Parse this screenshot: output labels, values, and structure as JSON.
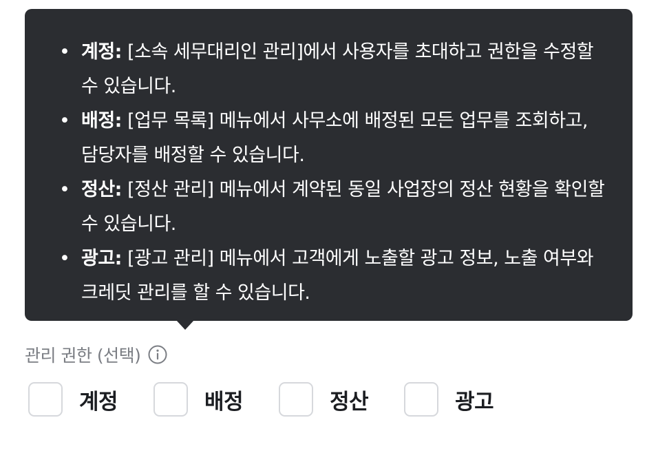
{
  "tooltip": {
    "items": [
      {
        "term": "계정:",
        "text": " [소속 세무대리인 관리]에서 사용자를 초대하고 권한을 수정할 수 있습니다."
      },
      {
        "term": "배정:",
        "text": " [업무 목록] 메뉴에서 사무소에 배정된 모든 업무를 조회하고, 담당자를 배정할 수 있습니다."
      },
      {
        "term": "정산:",
        "text": " [정산 관리] 메뉴에서 계약된 동일 사업장의 정산 현황을 확인할 수 있습니다."
      },
      {
        "term": "광고:",
        "text": " [광고 관리] 메뉴에서 고객에게 노출할 광고 정보, 노출 여부와 크레딧 관리를 할 수 있습니다."
      }
    ]
  },
  "permissions": {
    "label": "관리 권한 (선택)",
    "info_icon": "info-circle-icon",
    "options": [
      {
        "label": "계정",
        "checked": false
      },
      {
        "label": "배정",
        "checked": false
      },
      {
        "label": "정산",
        "checked": false
      },
      {
        "label": "광고",
        "checked": false
      }
    ]
  },
  "colors": {
    "tooltip_bg": "#2b2d31",
    "label_gray": "#7a7d83",
    "checkbox_border": "#d6d8dc"
  }
}
